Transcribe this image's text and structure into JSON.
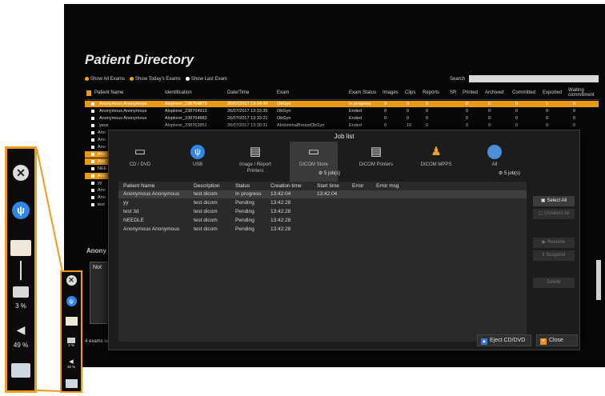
{
  "directory": {
    "title": "Patient Directory",
    "filters": [
      "Show All Exams",
      "Show Today's Exams",
      "Show Last Exam"
    ],
    "search_label": "Search",
    "search_value": "",
    "columns": [
      "Patient Name",
      "Identification",
      "Date/Time",
      "Exam",
      "Exam Status",
      "Images",
      "Clips",
      "Reports",
      "SR",
      "Printed",
      "Archived",
      "Committed",
      "Exported",
      "Waiting commitment"
    ],
    "rows": [
      {
        "name": "Anonymous Anonymous",
        "id": "Aloplorer_238764873",
        "datetime": "26/07/2017 13:34:34",
        "exam": "ObGyn",
        "status": "In progress",
        "counts": [
          "3",
          "0",
          "0",
          "",
          "0",
          "0",
          "0",
          "1",
          "0"
        ]
      },
      {
        "name": "Anonymous Anonymous",
        "id": "Aloplorer_238764913",
        "datetime": "26/07/2017 13:33:35",
        "exam": "ObGyn",
        "status": "Ended",
        "counts": [
          "0",
          "0",
          "0",
          "",
          "0",
          "0",
          "0",
          "0",
          "0"
        ]
      },
      {
        "name": "Anonymous Anonymous",
        "id": "Aloplorer_238764883",
        "datetime": "26/07/2017 13:33:21",
        "exam": "ObGyn",
        "status": "Ended",
        "counts": [
          "0",
          "0",
          "0",
          "",
          "0",
          "0",
          "0",
          "0",
          "0"
        ]
      },
      {
        "name": "yeux",
        "id": "Aloplorer_238763851",
        "datetime": "26/07/2017 13:30:31",
        "exam": "AbdominalBreastObGyn",
        "status": "Ended",
        "counts": [
          "0",
          "10",
          "0",
          "",
          "0",
          "0",
          "0",
          "0",
          "0"
        ]
      }
    ],
    "stub_rows": [
      "Ano",
      "Ano",
      "Ano",
      "Ano",
      "Ano",
      "NEE",
      "Ano",
      "yy",
      "Ano",
      "Ano",
      "test"
    ],
    "preview_name": "Anony",
    "preview_label": "Not",
    "exams_selected": "4 exams se"
  },
  "joblist": {
    "title": "Job list",
    "destinations": [
      {
        "label": "CD / DVD",
        "icon": "disc-drive-icon"
      },
      {
        "label": "USB",
        "icon": "usb-icon"
      },
      {
        "label": "Image / Report Printers",
        "icon": "printer-icon"
      },
      {
        "label": "DICOM Store",
        "icon": "dicom-store-icon"
      },
      {
        "label": "DICOM Printers",
        "icon": "dicom-printer-icon"
      },
      {
        "label": "DICOM MPPS",
        "icon": "mpps-icon"
      },
      {
        "label": "All",
        "icon": "globe-icon"
      }
    ],
    "dicom_jobs": "5 job(s)",
    "all_jobs": "5 job(s)",
    "columns": [
      "Patient Name",
      "Description",
      "Status",
      "Creation time",
      "Start time",
      "Error",
      "Error msg"
    ],
    "rows": [
      {
        "patient": "Anonymous Anonymous",
        "description": "test dicom",
        "status": "In progress",
        "creation": "13:42:04",
        "start": "13:42:04"
      },
      {
        "patient": "yy",
        "description": "test dicom",
        "status": "Pending",
        "creation": "13:42:28",
        "start": ""
      },
      {
        "patient": "test 3d",
        "description": "test dicom",
        "status": "Pending",
        "creation": "13:42:28",
        "start": ""
      },
      {
        "patient": "NEEDLE",
        "description": "test dicom",
        "status": "Pending",
        "creation": "13:42:28",
        "start": ""
      },
      {
        "patient": "Anonymous Anonymous",
        "description": "test dicom",
        "status": "Pending",
        "creation": "13:42:28",
        "start": ""
      }
    ],
    "buttons": {
      "select_all": "Select All",
      "unselect_all": "Unselect All",
      "resume": "Resume",
      "suspend": "Suspend",
      "delete": "Delete"
    },
    "eject": "Eject CD/DVD",
    "close": "Close"
  },
  "toolbar": {
    "printer_percent": "3 %",
    "volume_percent": "49 %",
    "small_printer_percent": "3 %",
    "small_volume_percent": "49 %"
  },
  "colors": {
    "accent": "#f29a1a",
    "usb_blue": "#2f86e8",
    "selected_row": "#e89a12"
  }
}
